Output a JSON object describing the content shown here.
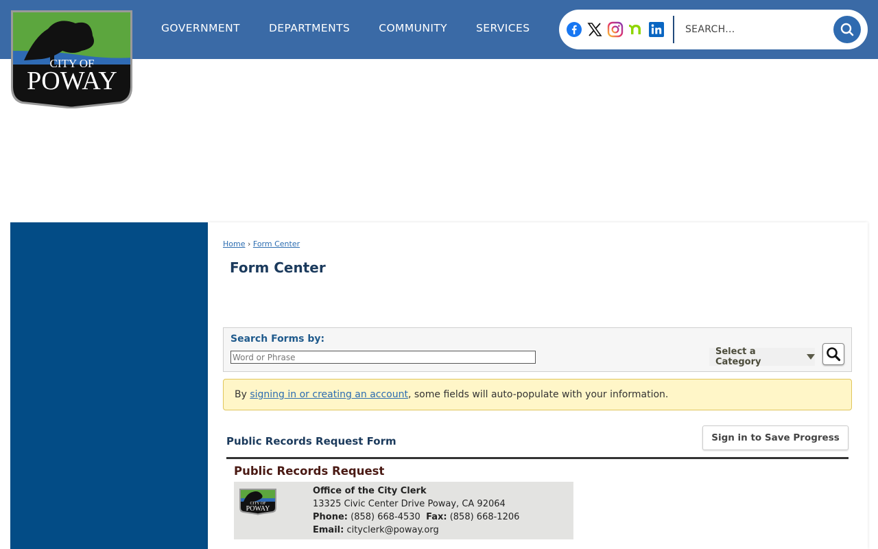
{
  "header": {
    "logo_text_top": "CITY OF",
    "logo_text_bottom": "POWAY",
    "nav": [
      "GOVERNMENT",
      "DEPARTMENTS",
      "COMMUNITY",
      "SERVICES"
    ],
    "social_icons": [
      "facebook-icon",
      "x-icon",
      "instagram-icon",
      "nextdoor-icon",
      "linkedin-icon"
    ],
    "search_placeholder": "SEARCH...",
    "bar_color": "#3a6aa6"
  },
  "sidebar": {
    "color": "#034c86"
  },
  "breadcrumb": {
    "home": "Home",
    "separator": "›",
    "current": "Form Center"
  },
  "page_title": "Form Center",
  "search_forms": {
    "label": "Search Forms by:",
    "placeholder": "Word or Phrase",
    "category_label": "Select a Category"
  },
  "notice": {
    "prefix": "By ",
    "link": "signing in or creating an account",
    "suffix": ", some fields will auto-populate with your information."
  },
  "form": {
    "title": "Public Records Request Form",
    "save_button": "Sign in to Save Progress",
    "heading": "Public Records Request",
    "office": "Office of the City Clerk",
    "address": "13325 Civic Center Drive Poway, CA 92064",
    "phone_label": "Phone:",
    "phone": "(858) 668-4530",
    "fax_label": "Fax:",
    "fax": "(858) 668-1206",
    "email_label": "Email:",
    "email": "cityclerk@poway.org"
  }
}
